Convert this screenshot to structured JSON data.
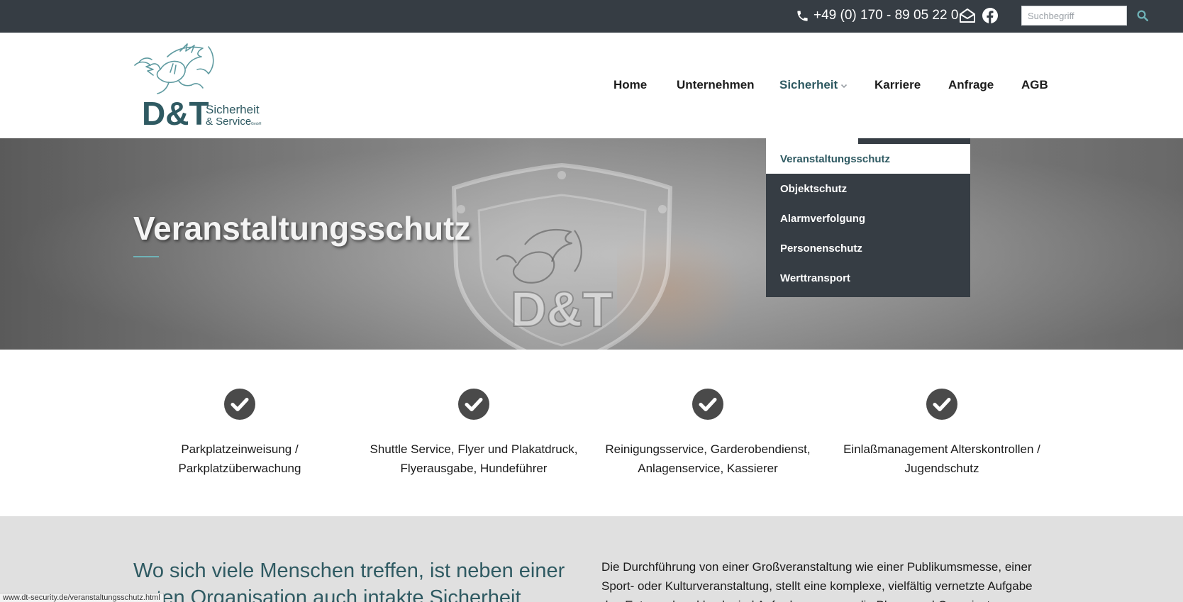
{
  "topbar": {
    "phone": "+49 (0) 170 - 89 05 22 0",
    "phone_icon": "phone-icon",
    "mail_icon": "mail-open-icon",
    "facebook_icon": "facebook-icon",
    "search_placeholder": "Suchbegriff",
    "search_icon": "search-icon"
  },
  "logo": {
    "brand": "D&T",
    "line1": "Sicherheit",
    "line2": "& Service",
    "suffix": "GmbH"
  },
  "nav": {
    "items": [
      {
        "label": "Home"
      },
      {
        "label": "Unternehmen"
      },
      {
        "label": "Sicherheit",
        "active": true
      },
      {
        "label": "Karriere"
      },
      {
        "label": "Anfrage"
      },
      {
        "label": "AGB"
      }
    ]
  },
  "dropdown": {
    "items": [
      {
        "label": "Veranstaltungsschutz",
        "active": true
      },
      {
        "label": "Objektschutz"
      },
      {
        "label": "Alarmverfolgung"
      },
      {
        "label": "Personenschutz"
      },
      {
        "label": "Werttransport"
      }
    ]
  },
  "hero": {
    "title": "Veranstaltungsschutz",
    "watermark": "D&T"
  },
  "features": [
    {
      "line1": "Parkplatzeinweisung /",
      "line2": "Parkplatzüberwachung",
      "icon": "check-circle-icon"
    },
    {
      "line1": "Shuttle Service, Flyer und Plakatdruck,",
      "line2": "Flyerausgabe, Hundeführer",
      "icon": "check-circle-icon"
    },
    {
      "line1": "Reinigungsservice, Garderobendienst,",
      "line2": "Anlagenservice, Kassierer",
      "icon": "check-circle-icon"
    },
    {
      "line1": "Einlaßmanagement Alterskontrollen /",
      "line2": "Jugendschutz",
      "icon": "check-circle-icon"
    }
  ],
  "intro": {
    "heading": "Wo sich viele Menschen treffen, ist neben einer guten Organisation auch intakte Sicherheit",
    "text": "Die Durchführung von einer Großveranstaltung wie einer Publikumsmesse, einer Sport- oder Kulturveranstaltung, stellt eine komplexe, vielfältig vernetzte Aufgabe dar. Entsprechend hoch sind Anforderungen an die Planer und Organisatoren."
  },
  "statusbar": {
    "url": "www.dt-security.de/veranstaltungsschutz.html"
  },
  "colors": {
    "topbar": "#363d44",
    "accent": "#2f5a62",
    "accent_light": "#6fb3b8",
    "bottom_bg": "#e0e0e0"
  }
}
